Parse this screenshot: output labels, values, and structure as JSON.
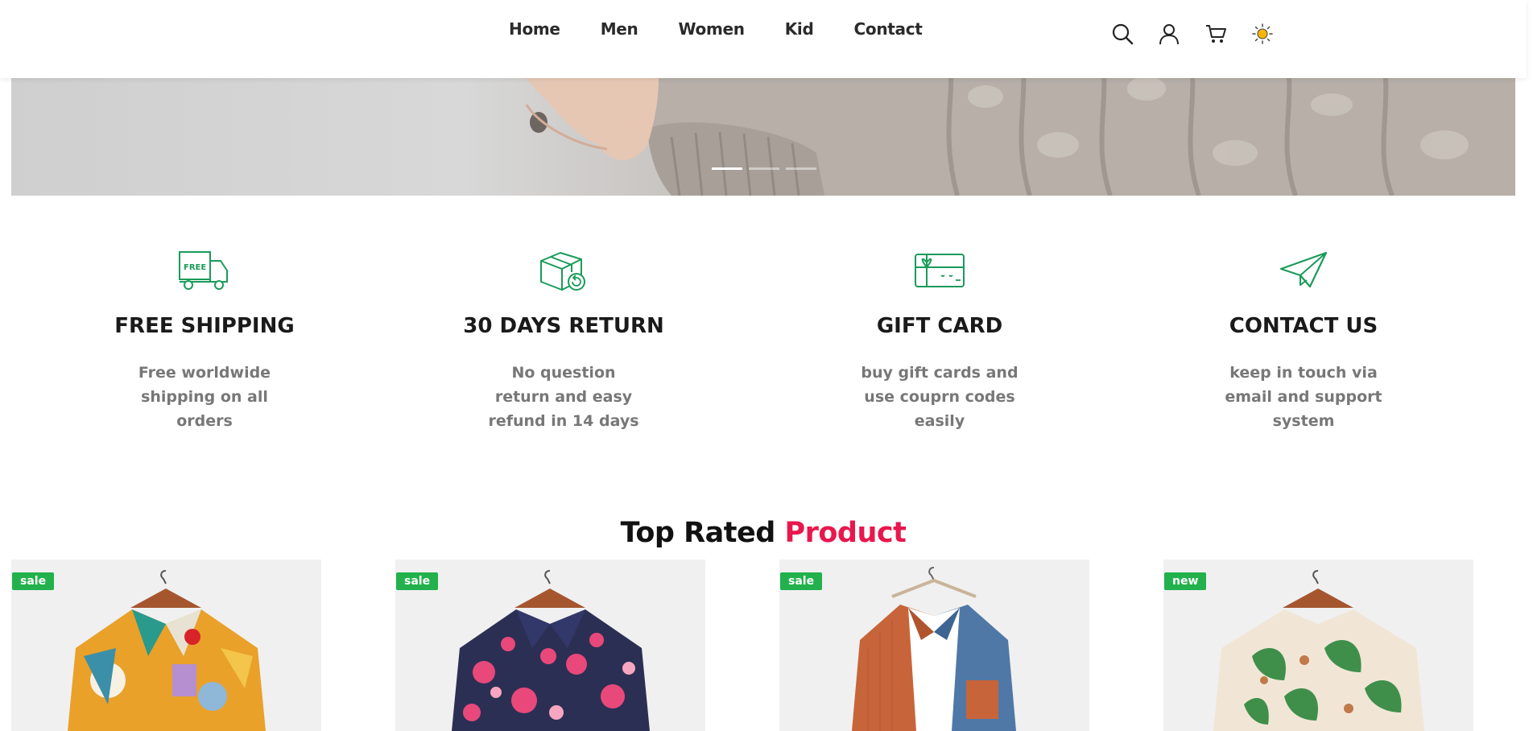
{
  "nav": {
    "items": [
      "Home",
      "Men",
      "Women",
      "Kid",
      "Contact"
    ]
  },
  "header_icons": [
    "search-icon",
    "user-icon",
    "cart-icon",
    "sun-icon"
  ],
  "hero": {
    "slides": 3,
    "active_slide": 1
  },
  "features": [
    {
      "icon": "free-truck-icon",
      "title": "FREE SHIPPING",
      "text": "Free worldwide shipping on all orders"
    },
    {
      "icon": "box-return-icon",
      "title": "30 DAYS RETURN",
      "text": "No question return and easy refund in 14 days"
    },
    {
      "icon": "gift-card-icon",
      "title": "GIFT CARD",
      "text": "buy gift cards and use couprn codes easily"
    },
    {
      "icon": "paper-plane-icon",
      "title": "CONTACT US",
      "text": "keep in touch via email and support system"
    }
  ],
  "section": {
    "title_main": "Top Rated",
    "title_accent": "Product"
  },
  "products": [
    {
      "badge": "sale",
      "image": "colorful-abstract-shirt"
    },
    {
      "badge": "sale",
      "image": "navy-floral-shirt"
    },
    {
      "badge": "sale",
      "image": "orange-blue-corduroy-shirt"
    },
    {
      "badge": "new",
      "image": "tropical-leaf-shirt"
    }
  ],
  "colors": {
    "accent": "#e8174d",
    "icon_green": "#1a9b5a",
    "badge_green": "#22b14c",
    "text_muted": "#777777"
  }
}
